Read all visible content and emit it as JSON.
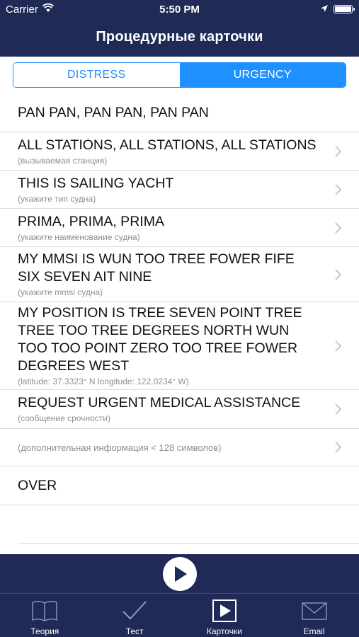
{
  "status_bar": {
    "carrier": "Carrier",
    "time": "5:50 PM"
  },
  "header": {
    "title": "Процедурные карточки"
  },
  "segments": [
    {
      "label": "DISTRESS",
      "selected": false
    },
    {
      "label": "URGENCY",
      "selected": true
    }
  ],
  "rows": [
    {
      "main": "PAN PAN, PAN PAN, PAN PAN",
      "sub": "",
      "chevron": false
    },
    {
      "main": "ALL STATIONS, ALL STATIONS, ALL STATIONS",
      "sub": "(вызываемая станция)",
      "chevron": true
    },
    {
      "main": "THIS IS SAILING YACHT",
      "sub": "(укажите тип судна)",
      "chevron": true
    },
    {
      "main": "PRIMA, PRIMA, PRIMA",
      "sub": "(укажите наименование судна)",
      "chevron": true
    },
    {
      "main": "MY MMSI IS WUN TOO TREE FOWER FIFE SIX SEVEN AIT NINE",
      "sub": "(укажите mmsi судна)",
      "chevron": true
    },
    {
      "main": "MY POSITION IS  TREE SEVEN POINT TREE TREE TOO TREE DEGREES NORTH  WUN TOO TOO POINT ZERO TOO TREE FOWER DEGREES WEST",
      "sub": "(latitude: 37.3323° N longitude: 122.0234° W)",
      "chevron": true
    },
    {
      "main": "REQUEST URGENT MEDICAL ASSISTANCE",
      "sub": "(сообщение срочности)",
      "chevron": true
    },
    {
      "main": "",
      "sub": "(дополнительная информация < 128 символов)",
      "chevron": true
    },
    {
      "main": "OVER",
      "sub": "",
      "chevron": false
    }
  ],
  "tabs": [
    {
      "label": "Теория",
      "icon": "book-icon",
      "active": false
    },
    {
      "label": "Тест",
      "icon": "checkmark-icon",
      "active": false
    },
    {
      "label": "Карточки",
      "icon": "play-card-icon",
      "active": true
    },
    {
      "label": "Email",
      "icon": "envelope-icon",
      "active": false
    }
  ],
  "colors": {
    "nav_bg": "#1f2a57",
    "accent": "#1e90ff"
  }
}
